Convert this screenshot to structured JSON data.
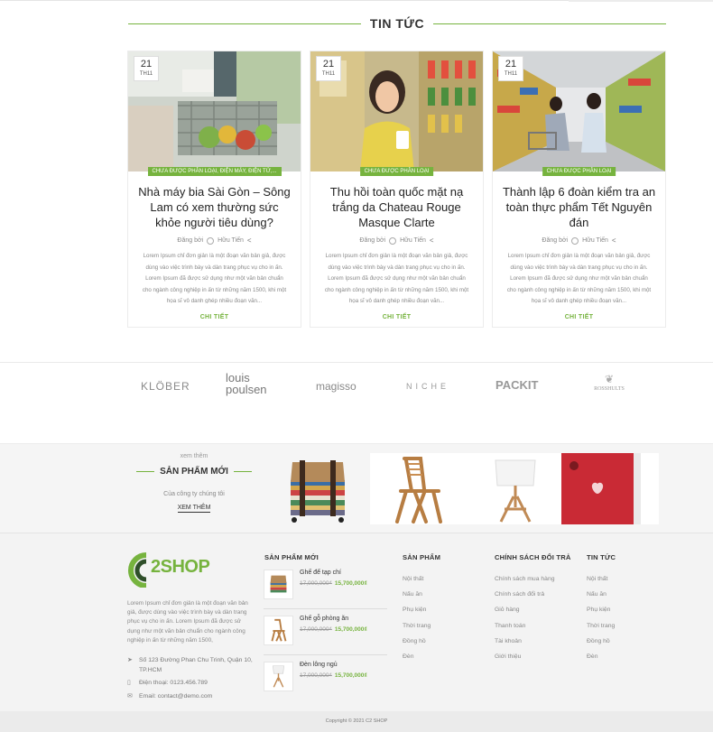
{
  "news": {
    "section_title": "TIN TỨC",
    "posts": [
      {
        "date_day": "21",
        "date_month": "TH11",
        "category": "CHƯA ĐƯỢC PHÂN LOẠI, ĐIỆN MÁY, ĐIỆN TỬ,...",
        "title": "Nhà máy bia Sài Gòn – Sông Lam có xem thường sức khỏe người tiêu dùng?",
        "posted_by": "Đăng bởi",
        "author": "Hữu Tiến",
        "excerpt": "Lorem Ipsum chỉ đơn giản là một đoạn văn bản giả, được dùng vào việc trình bày và dàn trang phục vụ cho in ấn. Lorem Ipsum đã được sử dụng như một văn bản chuẩn cho ngành công nghiệp in ấn từ những năm 1500, khi một họa sĩ vô danh ghép nhiều đoạn văn...",
        "more": "CHI TIẾT"
      },
      {
        "date_day": "21",
        "date_month": "TH11",
        "category": "CHƯA ĐƯỢC PHÂN LOẠI",
        "title": "Thu hồi toàn quốc mặt nạ trắng da Chateau Rouge Masque Clarte",
        "posted_by": "Đăng bởi",
        "author": "Hữu Tiến",
        "excerpt": "Lorem Ipsum chỉ đơn giản là một đoạn văn bản giả, được dùng vào việc trình bày và dàn trang phục vụ cho in ấn. Lorem Ipsum đã được sử dụng như một văn bản chuẩn cho ngành công nghiệp in ấn từ những năm 1500, khi một họa sĩ vô danh ghép nhiều đoạn văn...",
        "more": "CHI TIẾT"
      },
      {
        "date_day": "21",
        "date_month": "TH11",
        "category": "CHƯA ĐƯỢC PHÂN LOẠI",
        "title": "Thành lập 6 đoàn kiểm tra an toàn thực phẩm Tết Nguyên đán",
        "posted_by": "Đăng bởi",
        "author": "Hữu Tiến",
        "excerpt": "Lorem Ipsum chỉ đơn giản là một đoạn văn bản giả, được dùng vào việc trình bày và dàn trang phục vụ cho in ấn. Lorem Ipsum đã được sử dụng như một văn bản chuẩn cho ngành công nghiệp in ấn từ những năm 1500, khi một họa sĩ vô danh ghép nhiều đoạn văn...",
        "more": "CHI TIẾT"
      }
    ]
  },
  "brands": {
    "kloeber": "KLÖBER",
    "louis_line1": "louis",
    "louis_line2": "poulsen",
    "magisso": "magisso",
    "niche": "NICHE",
    "packit": "PACKIT",
    "rosshults": "ROSSHULTS"
  },
  "new_products_band": {
    "subtitle": "xem thêm",
    "title": "SẢN PHẨM MỚI",
    "description": "Của công ty chúng tôi",
    "link": "XEM THÊM"
  },
  "footer": {
    "logo_text": "2SHOP",
    "about": "Lorem Ipsum chỉ đơn giản là một đoạn văn bản giả, được dùng vào việc trình bày và dàn trang phục vụ cho in ấn. Lorem Ipsum đã được sử dụng như một văn bản chuẩn cho ngành công nghiệp in ấn từ những năm 1500,",
    "address": "Số 123 Đường Phan Chu Trinh, Quận 10, TP.HCM",
    "phone": "Điện thoại: 0123.456.789",
    "email": "Email: contact@demo.com",
    "new_products_title": "SẢN PHẨM MỚI",
    "new_products": [
      {
        "name": "Ghế để tạp chí",
        "old_price": "17,000,000₫",
        "new_price": "15,700,000₫"
      },
      {
        "name": "Ghế gỗ phòng ăn",
        "old_price": "17,000,000₫",
        "new_price": "15,700,000₫"
      },
      {
        "name": "Đèn lông ngủ",
        "old_price": "17,000,000₫",
        "new_price": "15,700,000₫"
      }
    ],
    "col_products_title": "SẢN PHẨM",
    "col_products": [
      "Nội thất",
      "Nấu ăn",
      "Phụ kiện",
      "Thời trang",
      "Đồng hồ",
      "Đèn"
    ],
    "col_policy_title": "CHÍNH SÁCH ĐỔI TRẢ",
    "col_policy": [
      "Chính sách mua hàng",
      "Chính sách đổi trả",
      "Giỏ hàng",
      "Thanh toán",
      "Tài khoản",
      "Giới thiệu"
    ],
    "col_news_title": "TIN TỨC",
    "col_news": [
      "Nội thất",
      "Nấu ăn",
      "Phụ kiện",
      "Thời trang",
      "Đồng hồ",
      "Đèn"
    ],
    "copyright": "Copyright © 2021 C2 SHOP"
  },
  "colors": {
    "accent": "#76b33e",
    "footer_bg": "#f3f3f3"
  }
}
